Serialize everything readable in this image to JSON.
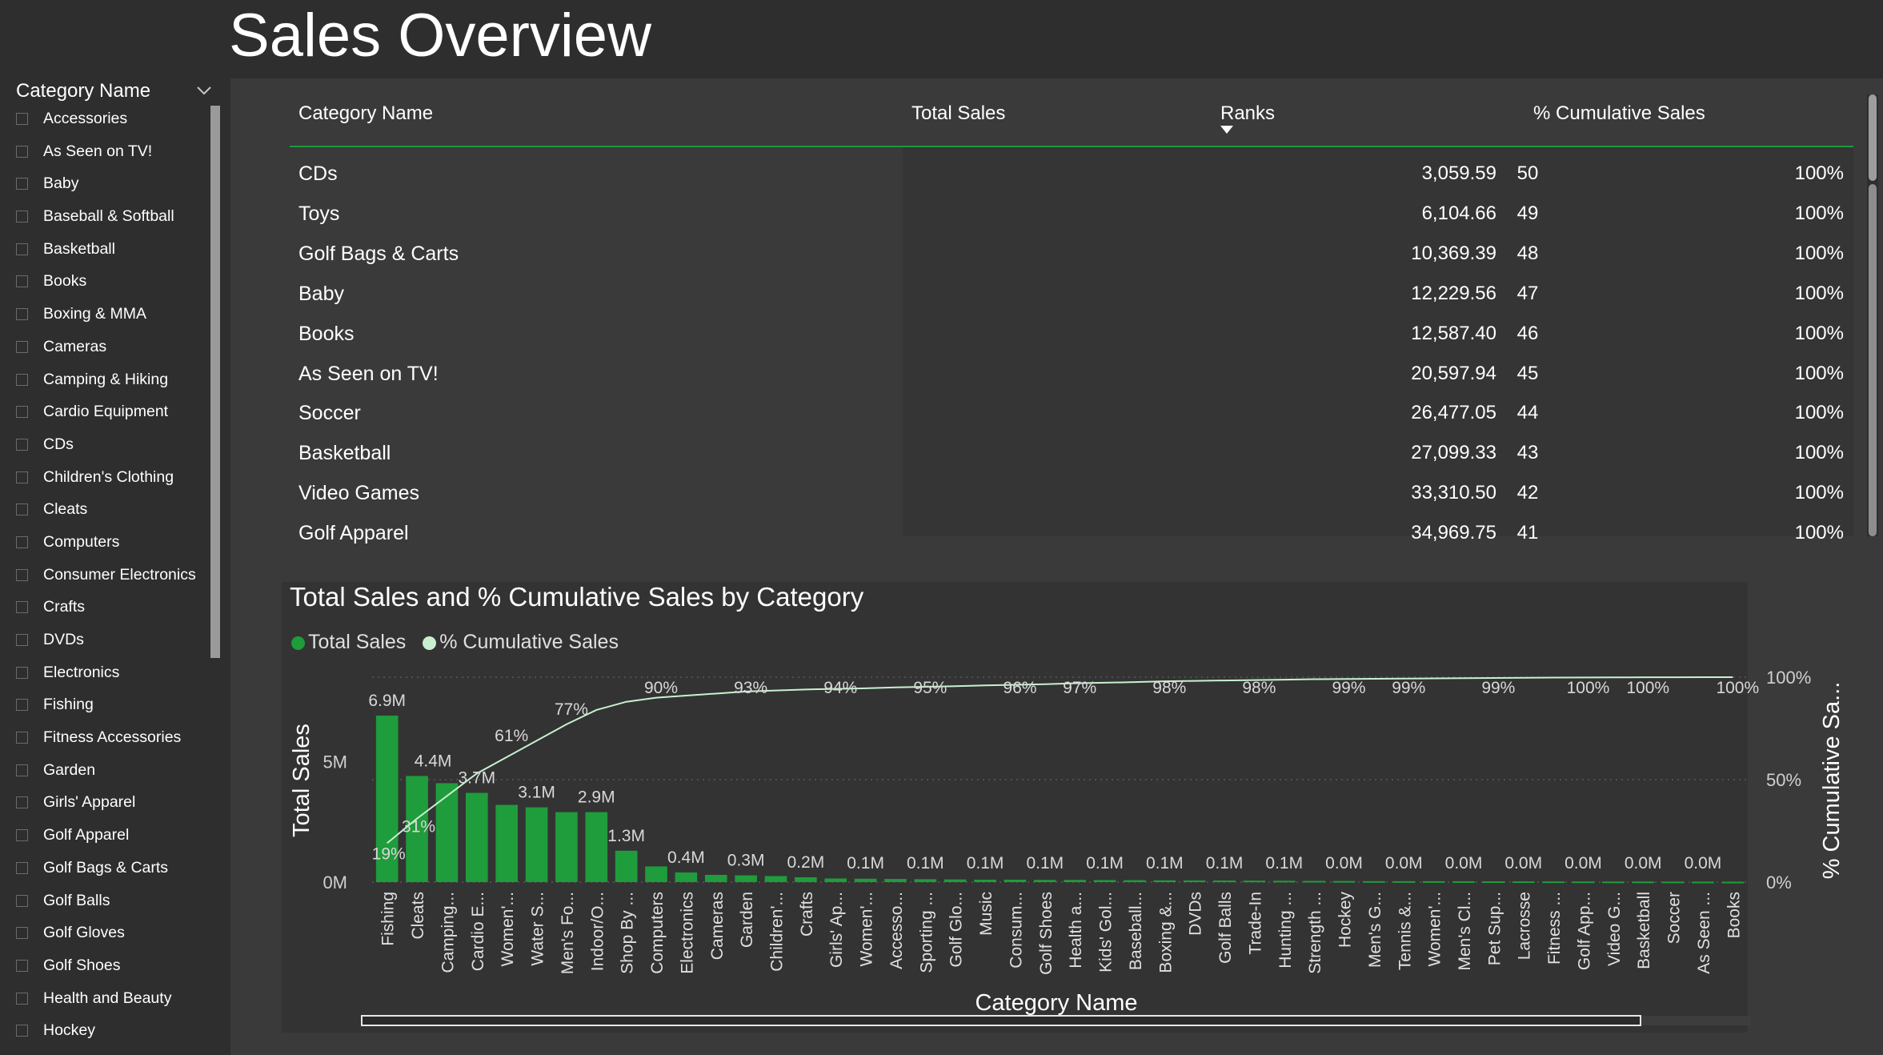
{
  "page": {
    "title": "Sales Overview"
  },
  "slicer": {
    "title": "Category Name",
    "items": [
      "Accessories",
      "As Seen on TV!",
      "Baby",
      "Baseball & Softball",
      "Basketball",
      "Books",
      "Boxing & MMA",
      "Cameras",
      "Camping & Hiking",
      "Cardio Equipment",
      "CDs",
      "Children's Clothing",
      "Cleats",
      "Computers",
      "Consumer Electronics",
      "Crafts",
      "DVDs",
      "Electronics",
      "Fishing",
      "Fitness Accessories",
      "Garden",
      "Girls' Apparel",
      "Golf Apparel",
      "Golf Bags & Carts",
      "Golf Balls",
      "Golf Gloves",
      "Golf Shoes",
      "Health and Beauty",
      "Hockey"
    ]
  },
  "table": {
    "headers": [
      "Category Name",
      "Total Sales",
      "Ranks",
      "% Cumulative Sales"
    ],
    "rows": [
      [
        "CDs",
        "3,059.59",
        "50",
        "100%"
      ],
      [
        "Toys",
        "6,104.66",
        "49",
        "100%"
      ],
      [
        "Golf Bags & Carts",
        "10,369.39",
        "48",
        "100%"
      ],
      [
        "Baby",
        "12,229.56",
        "47",
        "100%"
      ],
      [
        "Books",
        "12,587.40",
        "46",
        "100%"
      ],
      [
        "As Seen on TV!",
        "20,597.94",
        "45",
        "100%"
      ],
      [
        "Soccer",
        "26,477.05",
        "44",
        "100%"
      ],
      [
        "Basketball",
        "27,099.33",
        "43",
        "100%"
      ],
      [
        "Video Games",
        "33,310.50",
        "42",
        "100%"
      ],
      [
        "Golf Apparel",
        "34,969.75",
        "41",
        "100%"
      ]
    ]
  },
  "chart_data": {
    "type": "bar",
    "title": "Total Sales and % Cumulative Sales by Category",
    "xlabel": "Category Name",
    "ylabel": "Total Sales",
    "y2label": "% Cumulative Sa...",
    "ylim": [
      0,
      7200000
    ],
    "y2lim": [
      0,
      100
    ],
    "yticks": [
      "0M",
      "5M"
    ],
    "y2ticks": [
      "0%",
      "50%",
      "100%"
    ],
    "legend": "top-left",
    "colors": {
      "bar": "#1f9c3b",
      "line": "#c8f0d0",
      "grid": "#5a5a5a"
    },
    "categories": [
      "Fishing",
      "Cleats",
      "Camping...",
      "Cardio E...",
      "Women'...",
      "Water S...",
      "Men's Fo...",
      "Indoor/O...",
      "Shop By ...",
      "Computers",
      "Electronics",
      "Cameras",
      "Garden",
      "Children'...",
      "Crafts",
      "Girls' Ap...",
      "Women'...",
      "Accesso...",
      "Sporting ...",
      "Golf Glo...",
      "Music",
      "Consum...",
      "Golf Shoes",
      "Health a...",
      "Kids' Gol...",
      "Baseball...",
      "Boxing &...",
      "DVDs",
      "Golf Balls",
      "Trade-In",
      "Hunting ...",
      "Strength ...",
      "Hockey",
      "Men's G...",
      "Tennis &...",
      "Women'...",
      "Men's Cl...",
      "Pet Sup...",
      "Lacrosse",
      "Fitness ...",
      "Golf App...",
      "Video G...",
      "Basketball",
      "Soccer",
      "As Seen ...",
      "Books"
    ],
    "series": [
      {
        "name": "Total Sales",
        "values": [
          6900000,
          4400000,
          4100000,
          3700000,
          3200000,
          3100000,
          2900000,
          2900000,
          1300000,
          650000,
          400000,
          300000,
          280000,
          250000,
          200000,
          150000,
          140000,
          130000,
          120000,
          110000,
          100000,
          100000,
          90000,
          90000,
          85000,
          80000,
          75000,
          70000,
          65000,
          60000,
          55000,
          50000,
          45000,
          40000,
          38000,
          36000,
          34000,
          32000,
          30000,
          28000,
          26000,
          24000,
          22000,
          20000,
          18000,
          15000
        ],
        "data_labels": [
          "6.9M",
          "4.4M",
          "",
          "3.7M",
          "",
          "3.1M",
          "",
          "2.9M",
          "1.3M",
          "",
          "0.4M",
          "",
          "0.3M",
          "",
          "0.2M",
          "",
          "0.1M",
          "",
          "0.1M",
          "",
          "0.1M",
          "",
          "0.1M",
          "",
          "0.1M",
          "",
          "0.1M",
          "",
          "0.1M",
          "",
          "0.1M",
          "",
          "0.0M",
          "",
          "0.0M",
          "",
          "0.0M",
          "",
          "0.0M",
          "",
          "0.0M",
          "",
          "0.0M",
          "",
          "0.0M",
          ""
        ]
      },
      {
        "name": "% Cumulative Sales",
        "values": [
          19,
          31,
          42,
          53,
          61,
          69,
          77,
          84,
          88,
          90,
          91,
          92,
          93,
          93.5,
          94,
          94.3,
          94.6,
          95,
          95.3,
          95.6,
          96,
          96.3,
          96.6,
          97,
          97.3,
          97.6,
          98,
          98.2,
          98.4,
          98.6,
          98.8,
          99,
          99.1,
          99.2,
          99.3,
          99.4,
          99.5,
          99.6,
          99.7,
          99.8,
          99.85,
          99.9,
          99.93,
          99.96,
          99.98,
          100
        ],
        "data_labels": [
          "19%",
          "31%",
          "",
          "",
          "61%",
          "",
          "77%",
          "",
          "",
          "90%",
          "",
          "",
          "93%",
          "",
          "",
          "94%",
          "",
          "",
          "95%",
          "",
          "",
          "96%",
          "",
          "97%",
          "",
          "",
          "98%",
          "",
          "",
          "98%",
          "",
          "",
          "99%",
          "",
          "99%",
          "",
          "",
          "99%",
          "",
          "",
          "100%",
          "",
          "100%",
          "",
          "",
          "100%"
        ]
      }
    ]
  }
}
